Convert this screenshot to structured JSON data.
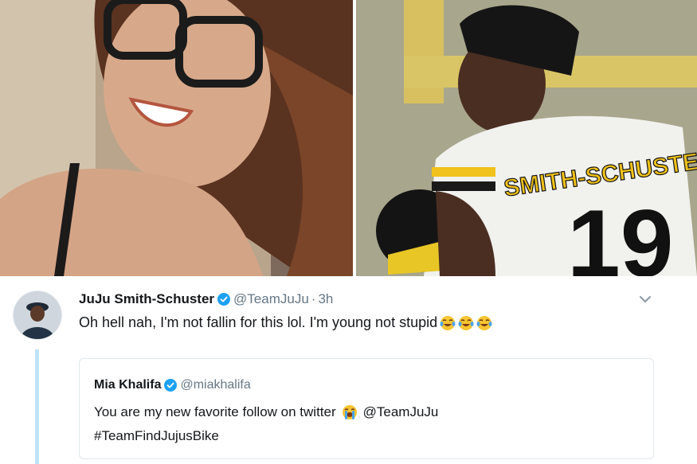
{
  "photos": {
    "left": {
      "icon": "woman-portrait-photo"
    },
    "right": {
      "icon": "football-player-photo",
      "jersey_name": "SMITH-SCHUSTER",
      "jersey_number": "19"
    }
  },
  "tweet": {
    "author_name": "JuJu Smith-Schuster",
    "handle": "@TeamJuJu",
    "separator": "·",
    "time": "3h",
    "text": "Oh hell nah, I'm not fallin for this lol. I'm young not stupid",
    "emojis": [
      "tears-of-joy-emoji",
      "tears-of-joy-emoji",
      "tears-of-joy-emoji"
    ],
    "colors": {
      "verified": "#1da1f2",
      "thread_line": "#bfe1fb",
      "muted": "#657786"
    }
  },
  "quoted_tweet": {
    "author_name": "Mia Khalifa",
    "handle": "@miakhalifa",
    "text_before_emoji": "You are my new favorite follow on twitter",
    "emoji": "loudly-crying-emoji",
    "text_after_emoji": "@TeamJuJu",
    "hashtag": "#TeamFindJujusBike"
  }
}
